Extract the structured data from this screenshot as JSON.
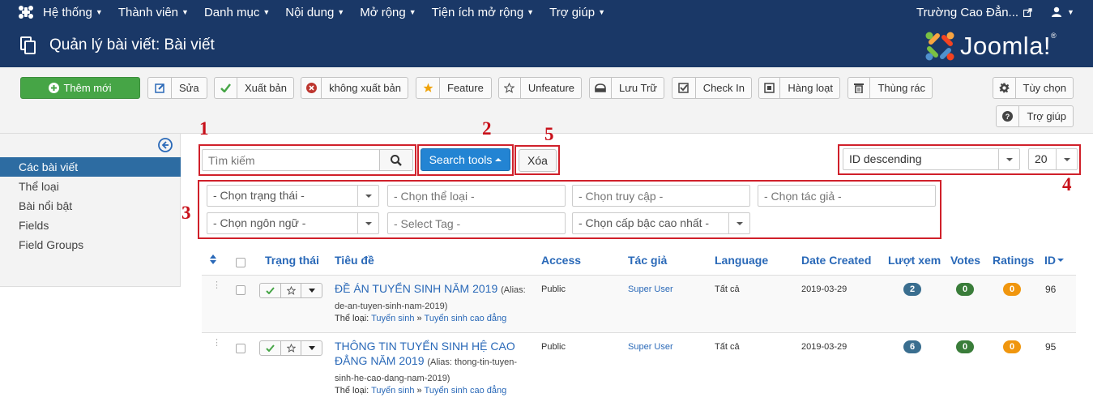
{
  "topnav": {
    "menu": [
      "Hệ thống",
      "Thành viên",
      "Danh mục",
      "Nội dung",
      "Mở rộng",
      "Tiện ích mở rộng",
      "Trợ giúp"
    ],
    "site_name": "Trường Cao Đẳn..."
  },
  "header": {
    "title": "Quản lý bài viết: Bài viết",
    "brand": "Joomla!",
    "brand_mark": "®"
  },
  "toolbar": {
    "new": "Thêm mới",
    "edit": "Sửa",
    "publish": "Xuất bản",
    "unpublish": "không xuất bản",
    "feature": "Feature",
    "unfeature": "Unfeature",
    "archive": "Lưu Trữ",
    "checkin": "Check In",
    "batch": "Hàng loạt",
    "trash": "Thùng rác",
    "options": "Tùy chọn",
    "help": "Trợ giúp"
  },
  "sidebar": {
    "items": [
      "Các bài viết",
      "Thể loại",
      "Bài nổi bật",
      "Fields",
      "Field Groups"
    ]
  },
  "filters": {
    "search_placeholder": "Tìm kiếm",
    "search_tools": "Search tools",
    "clear": "Xóa",
    "ordering": "ID descending",
    "limit": "20",
    "status": "- Chọn trạng thái -",
    "category": "- Chọn thể loại -",
    "access": "- Chọn truy cập -",
    "author": "- Chọn tác giả -",
    "language": "- Chọn ngôn ngữ -",
    "tag": "- Select Tag -",
    "level": "- Chọn cấp bậc cao nhất -"
  },
  "annotations": [
    "1",
    "2",
    "3",
    "4",
    "5"
  ],
  "table": {
    "headers": {
      "status": "Trạng thái",
      "title": "Tiêu đề",
      "access": "Access",
      "author": "Tác giả",
      "language": "Language",
      "date": "Date Created",
      "hits": "Lượt xem",
      "votes": "Votes",
      "ratings": "Ratings",
      "id": "ID"
    },
    "category_label": "Thể loại:",
    "rows": [
      {
        "title": "ĐỀ ÁN TUYỂN SINH NĂM 2019",
        "alias": "(Alias: de-an-tuyen-sinh-nam-2019)",
        "cat_parent": "Tuyển sinh",
        "cat_sep": "»",
        "cat_child": "Tuyển sinh cao đẳng",
        "access": "Public",
        "author": "Super User",
        "language": "Tất cả",
        "date": "2019-03-29",
        "hits": "2",
        "votes": "0",
        "ratings": "0",
        "id": "96"
      },
      {
        "title": "THÔNG TIN TUYỂN SINH HỆ CAO ĐẲNG NĂM 2019",
        "alias": "(Alias: thong-tin-tuyen-sinh-he-cao-dang-nam-2019)",
        "cat_parent": "Tuyển sinh",
        "cat_sep": "»",
        "cat_child": "Tuyển sinh cao đẳng",
        "access": "Public",
        "author": "Super User",
        "language": "Tất cả",
        "date": "2019-03-29",
        "hits": "6",
        "votes": "0",
        "ratings": "0",
        "id": "95"
      }
    ]
  },
  "colors": {
    "nav": "#1a3867",
    "green": "#46a546",
    "blue": "#2384d3",
    "link": "#2a69b8",
    "annotation_red": "#d0202a",
    "badge_hits": "#3a6e8f",
    "badge_votes": "#3a7d3a",
    "badge_ratings": "#f0960e"
  }
}
